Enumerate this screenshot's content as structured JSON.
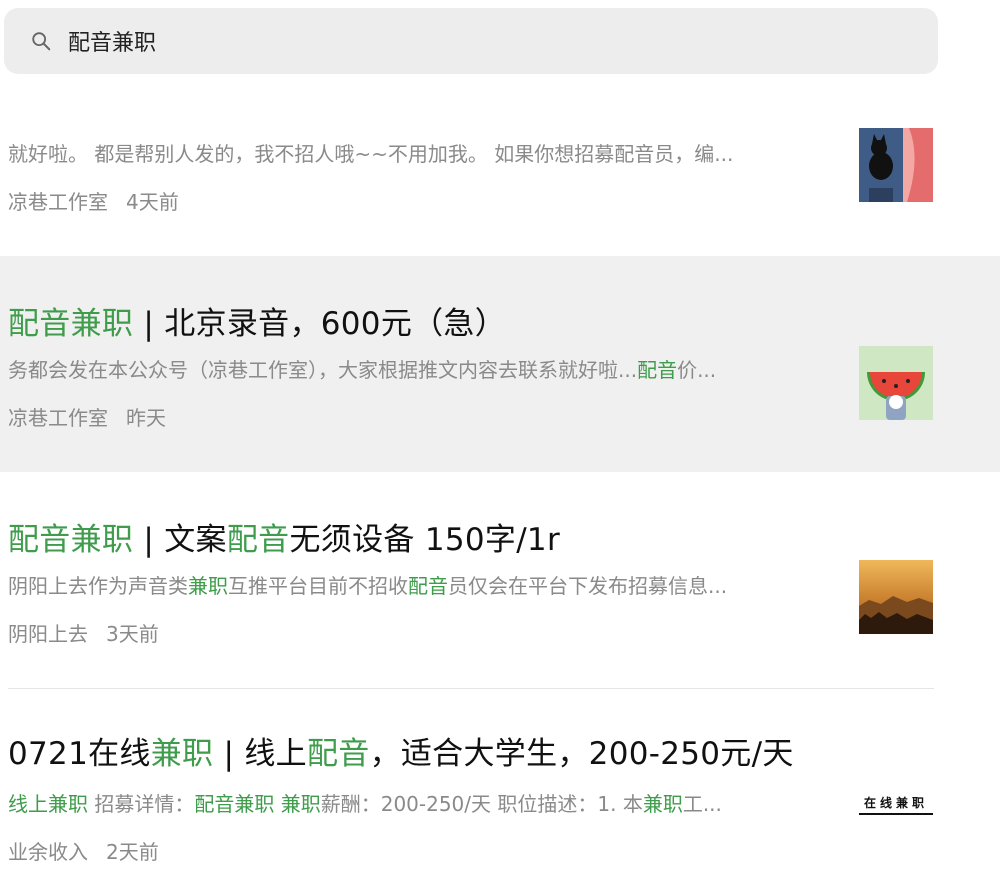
{
  "search": {
    "query": "配音兼职"
  },
  "results": [
    {
      "snippet": "就好啦。 都是帮别人发的，我不招人哦~~不用加我。 如果你想招募配音员，编...",
      "source": "凉巷工作室",
      "time": "4天前",
      "thumbnail_icon": "black-cat-illustration"
    },
    {
      "title_hl": "配音兼职",
      "title_rest": " | 北京录音，600元（急）",
      "snippet_pre": "务都会发在本公众号（凉巷工作室），大家根据推文内容去联系就好啦...",
      "snippet_hl": "配音",
      "snippet_post": "价...",
      "source": "凉巷工作室",
      "time": "昨天",
      "thumbnail_icon": "watermelon-illustration"
    },
    {
      "title_hl1": "配音兼职",
      "title_mid1": " | 文案",
      "title_hl2": "配音",
      "title_rest": "无须设备 150字/1r",
      "snippet_a": "阴阳上去作为声音类",
      "snippet_b": "兼职",
      "snippet_c": "互推平台目前不招收",
      "snippet_d": "配音",
      "snippet_e": "员仅会在平台下发布招募信息...",
      "source": "阴阳上去",
      "time": "3天前",
      "thumbnail_icon": "sunset-landscape-photo"
    },
    {
      "title_a": "0721在线",
      "title_b": "兼职",
      "title_c": " | 线上",
      "title_d": "配音",
      "title_e": "，适合大学生，200-250元/天",
      "snippet_a": "线上",
      "snippet_b": "兼职",
      "snippet_c": " 招募详情：",
      "snippet_d": "配音兼职 兼职",
      "snippet_e": "薪酬：200-250/天 职位描述：1. 本",
      "snippet_f": "兼职",
      "snippet_g": "工...",
      "source": "业余收入",
      "time": "2天前",
      "thumbnail_text": "在线兼职"
    }
  ],
  "colors": {
    "highlight": "#3e9c4b",
    "muted": "#8a8a8a",
    "row_highlight_bg": "#f0f0f0"
  }
}
